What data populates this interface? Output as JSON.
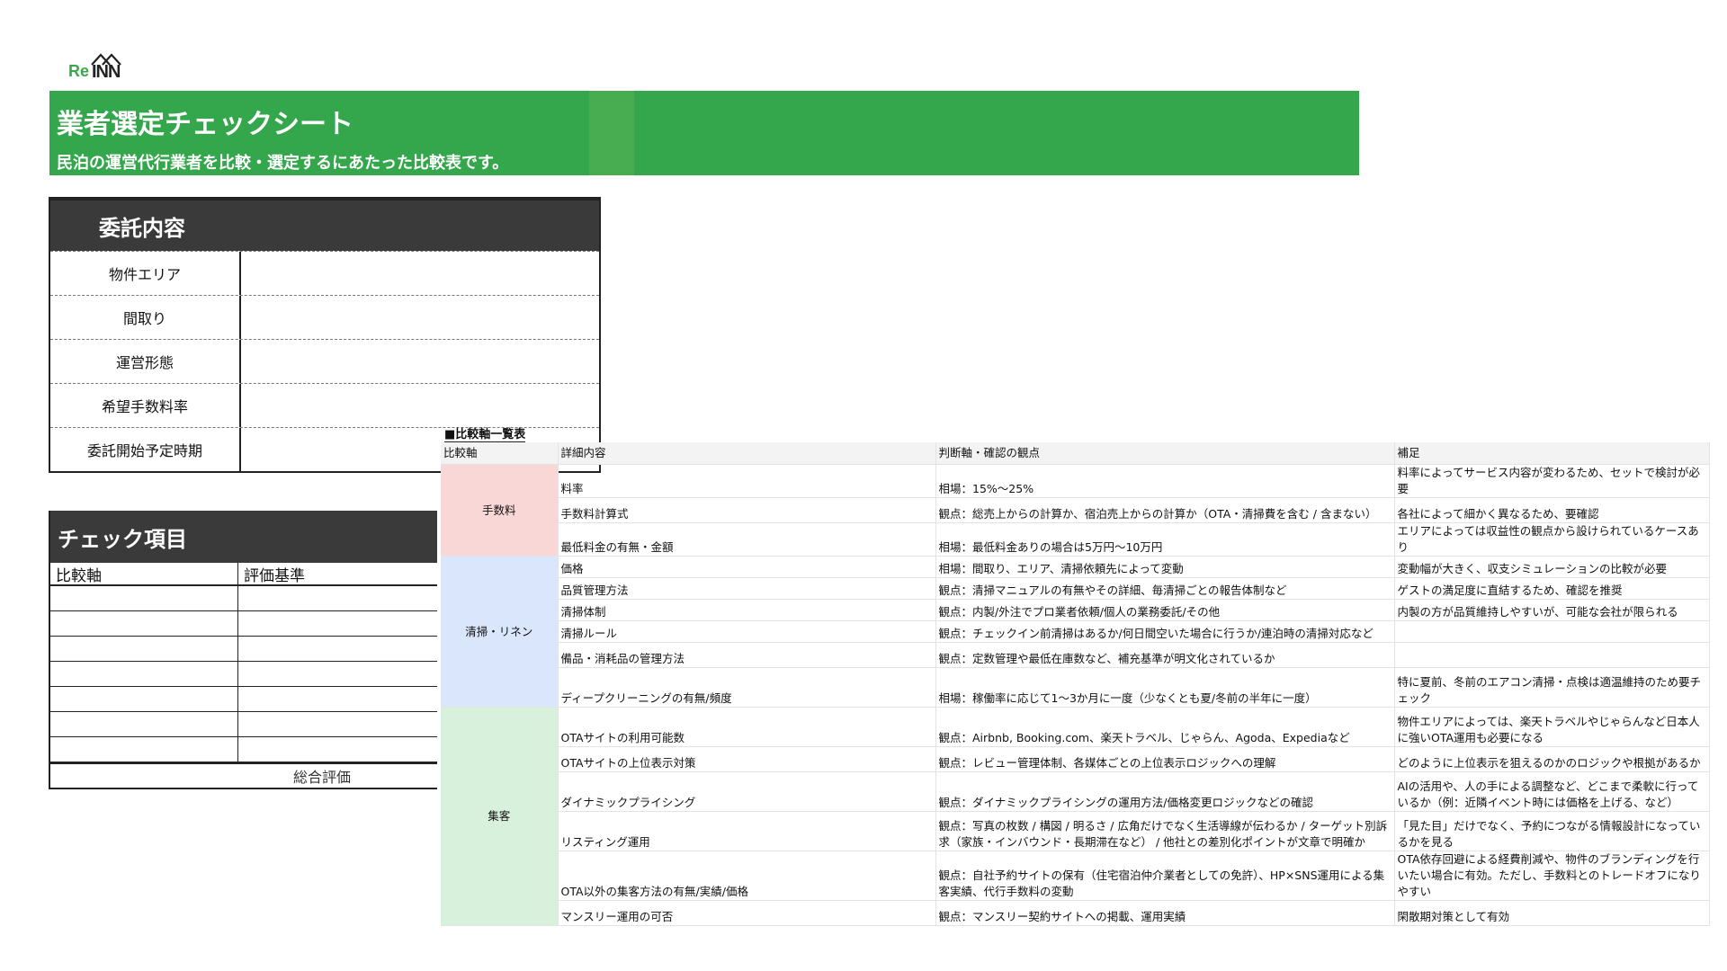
{
  "logo": {
    "re": "Re",
    "inn": "INN"
  },
  "banner": {
    "title": "業者選定チェックシート",
    "subtitle": "民泊の運営代行業者を比較・選定するにあたった比較表です。",
    "color": "#34a64c"
  },
  "itaku": {
    "title": "委託内容",
    "rows": [
      "物件エリア",
      "間取り",
      "運営形態",
      "希望手数料率",
      "委託開始予定時期"
    ]
  },
  "check": {
    "title": "チェック項目",
    "col1": "比較軸",
    "col2": "評価基準",
    "total": "総合評価"
  },
  "compare": {
    "title": "■比較軸一覧表",
    "headers": [
      "比較軸",
      "詳細内容",
      "判断軸・確認の観点",
      "補足"
    ],
    "categories": [
      {
        "name": "手数料",
        "color": "#f9d7d6",
        "rows": [
          {
            "detail": "料率",
            "view": "相場：15%〜25%",
            "note": "料率によってサービス内容が変わるため、セットで検討が必要"
          },
          {
            "detail": "手数料計算式",
            "view": "観点：総売上からの計算か、宿泊売上からの計算か（OTA・清掃費を含む / 含まない）",
            "note": "各社によって細かく異なるため、要確認"
          },
          {
            "detail": "最低料金の有無・金額",
            "view": "相場：最低料金ありの場合は5万円〜10万円",
            "note": "エリアによっては収益性の観点から設けられているケースあり"
          }
        ]
      },
      {
        "name": "清掃・リネン",
        "color": "#dae6fb",
        "rows": [
          {
            "detail": "価格",
            "view": "相場：間取り、エリア、清掃依頼先によって変動",
            "note": "変動幅が大きく、収支シミュレーションの比較が必要"
          },
          {
            "detail": "品質管理方法",
            "view": "観点：清掃マニュアルの有無やその詳細、毎清掃ごとの報告体制など",
            "note": "ゲストの満足度に直結するため、確認を推奨"
          },
          {
            "detail": "清掃体制",
            "view": "観点：内製/外注でプロ業者依頼/個人の業務委託/その他",
            "note": "内製の方が品質維持しやすいが、可能な会社が限られる"
          },
          {
            "detail": "清掃ルール",
            "view": "観点：チェックイン前清掃はあるか/何日間空いた場合に行うか/連泊時の清掃対応など",
            "note": ""
          },
          {
            "detail": "備品・消耗品の管理方法",
            "view": "観点：定数管理や最低在庫数など、補充基準が明文化されているか",
            "note": ""
          },
          {
            "detail": "ディープクリーニングの有無/頻度",
            "view": "相場：稼働率に応じて1〜3か月に一度（少なくとも夏/冬前の半年に一度）",
            "note": "特に夏前、冬前のエアコン清掃・点検は適温維持のため要チェック"
          }
        ]
      },
      {
        "name": "集客",
        "color": "#d8f1dc",
        "rows": [
          {
            "detail": "OTAサイトの利用可能数",
            "view": "観点：Airbnb, Booking.com、楽天トラベル、じゃらん、Agoda、Expediaなど",
            "note": "物件エリアによっては、楽天トラベルやじゃらんなど日本人に強いOTA運用も必要になる"
          },
          {
            "detail": "OTAサイトの上位表示対策",
            "view": "観点：レビュー管理体制、各媒体ごとの上位表示ロジックへの理解",
            "note": "どのように上位表示を狙えるのかのロジックや根拠があるか"
          },
          {
            "detail": "ダイナミックプライシング",
            "view": "観点：ダイナミックプライシングの運用方法/価格変更ロジックなどの確認",
            "note": "AIの活用や、人の手による調整など、どこまで柔軟に行っているか（例：近隣イベント時には価格を上げる、など）"
          },
          {
            "detail": "リスティング運用",
            "view": "観点：写真の枚数 / 構図 / 明るさ / 広角だけでなく生活導線が伝わるか / ターゲット別訴求（家族・インバウンド・長期滞在など） / 他社との差別化ポイントが文章で明確か",
            "note": "「見た目」だけでなく、予約につながる情報設計になっているかを見る"
          },
          {
            "detail": "OTA以外の集客方法の有無/実績/価格",
            "view": "観点：自社予約サイトの保有（住宅宿泊仲介業者としての免許）、HP×SNS運用による集客実績、代行手数料の変動",
            "note": "OTA依存回避による経費削減や、物件のブランディングを行いたい場合に有効。ただし、手数料とのトレードオフになりやすい"
          },
          {
            "detail": "マンスリー運用の可否",
            "view": "観点：マンスリー契約サイトへの掲載、運用実績",
            "note": "閑散期対策として有効"
          }
        ]
      }
    ]
  }
}
